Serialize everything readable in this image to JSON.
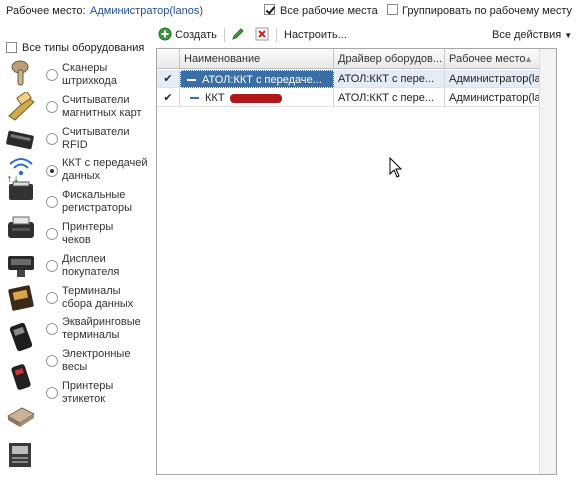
{
  "header": {
    "workplace_label": "Рабочее место:",
    "workplace_value": "Администратор(lanos)",
    "all_workplaces_label": "Все рабочие места",
    "group_by_workplace_label": "Группировать по рабочему месту"
  },
  "left": {
    "all_types_label": "Все типы оборудования",
    "device_types": [
      {
        "label": "Сканеры штрихкода",
        "icon": "barcode-scanner-icon",
        "selected": false
      },
      {
        "label": "Считыватели магнитных карт",
        "icon": "magnetic-card-reader-icon",
        "selected": false
      },
      {
        "label": "Считыватели RFID",
        "icon": "rfid-reader-icon",
        "selected": false
      },
      {
        "label": "ККТ с передачей данных",
        "icon": "kkt-transfer-icon",
        "selected": true
      },
      {
        "label": "Фискальные регистраторы",
        "icon": "fiscal-registrar-icon",
        "selected": false
      },
      {
        "label": "Принтеры чеков",
        "icon": "receipt-printer-icon",
        "selected": false
      },
      {
        "label": "Дисплеи покупателя",
        "icon": "customer-display-icon",
        "selected": false
      },
      {
        "label": "Терминалы сбора данных",
        "icon": "data-terminal-icon",
        "selected": false
      },
      {
        "label": "Эквайринговые терминалы",
        "icon": "acquiring-terminal-icon",
        "selected": false
      },
      {
        "label": "Электронные весы",
        "icon": "electronic-scales-icon",
        "selected": false
      },
      {
        "label": "Принтеры этикеток",
        "icon": "label-printer-icon",
        "selected": false
      }
    ]
  },
  "toolbar": {
    "create_label": "Создать",
    "configure_label": "Настроить...",
    "all_actions_label": "Все действия"
  },
  "table": {
    "columns": [
      "Наименование",
      "Драйвер оборудов...",
      "Рабочее место"
    ],
    "rows": [
      {
        "name": "АТОЛ:ККТ с передаче...",
        "driver": "АТОЛ:ККТ с перe...",
        "workplace": "Администратор(la...",
        "checked": true,
        "selected": true
      },
      {
        "name": "ККТ",
        "driver": "АТОЛ:ККТ с перe...",
        "workplace": "Администратор(la...",
        "checked": true,
        "selected": false
      }
    ]
  },
  "colors": {
    "link": "#1f4e9c",
    "selection": "#3a6ea5",
    "create_green": "#3c9a3c",
    "delete_red": "#cc2222"
  }
}
